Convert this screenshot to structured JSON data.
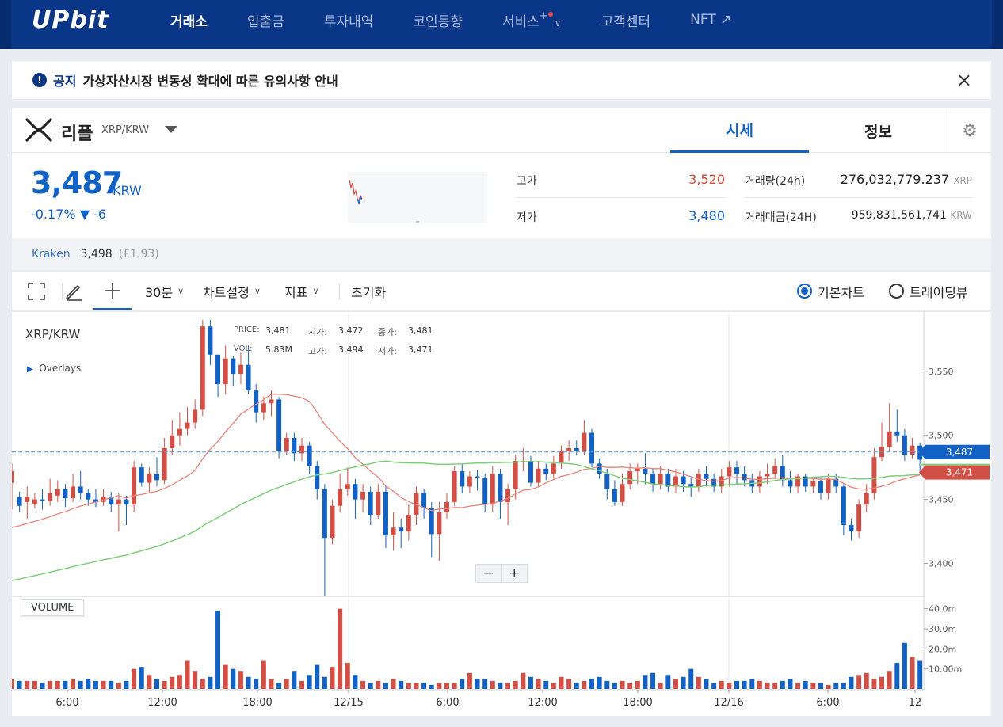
{
  "topnav": {
    "logo": "UPbit",
    "items": [
      "거래소",
      "입출금",
      "투자내역",
      "코인동향",
      "서비스",
      "고객센터",
      "NFT ↗"
    ],
    "plus": "+"
  },
  "notice": {
    "tag": "공지",
    "message": "가상자산시장 변동성 확대에 따른 유의사항 안내",
    "close": "×"
  },
  "coin": {
    "name": "리플",
    "pair": "XRP/KRW",
    "tabs": [
      "시세",
      "정보"
    ]
  },
  "price": {
    "current": "3,487",
    "unit": "KRW",
    "change": "-0.17% ▼ -6",
    "high_label": "고가",
    "high": "3,520",
    "low_label": "저가",
    "low": "3,480",
    "volume_label": "거래량(24h)",
    "volume": "276,032,779.237",
    "volume_unit": "XRP",
    "amount_label": "거래대금(24H)",
    "amount": "959,831,561,741",
    "amount_unit": "KRW"
  },
  "kraken": {
    "label": "Kraken",
    "price": "3,498",
    "gbp": "(£1.93)"
  },
  "toolbar": {
    "interval": "30분",
    "settings": "차트설정",
    "indicators": "지표",
    "reset": "초기화",
    "basic_chart": "기본차트",
    "trading_view": "트레이딩뷰"
  },
  "colors": {
    "up": "#d24f45",
    "down": "#1261c4",
    "brand": "#093687",
    "ma_short": "#e8837a",
    "ma_long": "#7fcf7a"
  },
  "chart_overlay": {
    "symbol": "XRP/KRW",
    "overlays": "Overlays",
    "price_label": "PRICE:",
    "price": "3,481",
    "open_label": "시가:",
    "open": "3,472",
    "close_label": "종가:",
    "close": "3,481",
    "vol_label": "VOL:",
    "vol": "5.83M",
    "high_label": "고가:",
    "high": "3,494",
    "low_label": "저가:",
    "low": "3,471",
    "volume_title": "VOLUME",
    "zoom_out": "−",
    "zoom_in": "+"
  },
  "chart_data": {
    "type": "candlestick",
    "x_tick_labels": [
      "6:00",
      "12:00",
      "18:00",
      "12/15",
      "6:00",
      "12:00",
      "18:00",
      "12/16",
      "6:00",
      "12"
    ],
    "y_tick_labels": [
      "3,550",
      "3,500",
      "3,450",
      "3,400"
    ],
    "ylim": [
      3375,
      3595
    ],
    "volume_tick_labels": [
      "40.0m",
      "30.0m",
      "20.0m",
      "10.00m"
    ],
    "volume_ylim": [
      0,
      45
    ],
    "current_price_tag": "3,487",
    "ma_tag": "3,471",
    "series": [
      {
        "name": "candles",
        "values": [
          [
            3463,
            3472,
            3478,
            3442
          ],
          [
            3452,
            3445,
            3456,
            3440
          ],
          [
            3448,
            3452,
            3460,
            3435
          ],
          [
            3446,
            3450,
            3455,
            3443
          ],
          [
            3450,
            3449,
            3458,
            3442
          ],
          [
            3449,
            3455,
            3466,
            3445
          ],
          [
            3453,
            3458,
            3465,
            3448
          ],
          [
            3458,
            3451,
            3462,
            3444
          ],
          [
            3451,
            3460,
            3470,
            3448
          ],
          [
            3460,
            3455,
            3472,
            3450
          ],
          [
            3455,
            3450,
            3458,
            3445
          ],
          [
            3450,
            3448,
            3458,
            3444
          ],
          [
            3448,
            3452,
            3458,
            3445
          ],
          [
            3452,
            3446,
            3456,
            3440
          ],
          [
            3446,
            3450,
            3455,
            3425
          ],
          [
            3450,
            3446,
            3453,
            3430
          ],
          [
            3446,
            3475,
            3480,
            3440
          ],
          [
            3475,
            3463,
            3478,
            3460
          ],
          [
            3463,
            3470,
            3475,
            3455
          ],
          [
            3470,
            3465,
            3483,
            3460
          ],
          [
            3465,
            3490,
            3498,
            3462
          ],
          [
            3490,
            3500,
            3512,
            3485
          ],
          [
            3500,
            3505,
            3518,
            3492
          ],
          [
            3505,
            3510,
            3522,
            3500
          ],
          [
            3510,
            3520,
            3528,
            3505
          ],
          [
            3520,
            3585,
            3590,
            3515
          ],
          [
            3585,
            3563,
            3590,
            3555
          ],
          [
            3563,
            3540,
            3558,
            3530
          ],
          [
            3540,
            3560,
            3570,
            3532
          ],
          [
            3560,
            3548,
            3562,
            3538
          ],
          [
            3548,
            3555,
            3565,
            3540
          ],
          [
            3555,
            3535,
            3570,
            3532
          ],
          [
            3535,
            3518,
            3540,
            3510
          ],
          [
            3518,
            3525,
            3530,
            3512
          ],
          [
            3525,
            3528,
            3535,
            3515
          ],
          [
            3528,
            3488,
            3530,
            3482
          ],
          [
            3488,
            3498,
            3502,
            3485
          ],
          [
            3498,
            3486,
            3502,
            3480
          ],
          [
            3486,
            3492,
            3498,
            3480
          ],
          [
            3492,
            3476,
            3495,
            3470
          ],
          [
            3476,
            3458,
            3480,
            3450
          ],
          [
            3458,
            3420,
            3462,
            3375
          ],
          [
            3420,
            3445,
            3450,
            3415
          ],
          [
            3445,
            3458,
            3470,
            3440
          ],
          [
            3458,
            3462,
            3475,
            3453
          ],
          [
            3462,
            3450,
            3466,
            3435
          ],
          [
            3450,
            3456,
            3462,
            3440
          ],
          [
            3456,
            3438,
            3460,
            3430
          ],
          [
            3438,
            3456,
            3462,
            3435
          ],
          [
            3456,
            3422,
            3460,
            3412
          ],
          [
            3422,
            3428,
            3440,
            3410
          ],
          [
            3428,
            3425,
            3435,
            3412
          ],
          [
            3425,
            3438,
            3446,
            3418
          ],
          [
            3438,
            3455,
            3460,
            3430
          ],
          [
            3455,
            3443,
            3458,
            3435
          ],
          [
            3443,
            3423,
            3448,
            3405
          ],
          [
            3423,
            3440,
            3448,
            3402
          ],
          [
            3440,
            3448,
            3455,
            3435
          ],
          [
            3448,
            3472,
            3476,
            3445
          ],
          [
            3472,
            3460,
            3478,
            3455
          ],
          [
            3460,
            3468,
            3472,
            3455
          ],
          [
            3468,
            3467,
            3473,
            3457
          ],
          [
            3467,
            3446,
            3470,
            3440
          ],
          [
            3446,
            3470,
            3476,
            3440
          ],
          [
            3470,
            3448,
            3474,
            3435
          ],
          [
            3448,
            3458,
            3462,
            3430
          ],
          [
            3458,
            3480,
            3485,
            3450
          ],
          [
            3480,
            3480,
            3490,
            3472
          ],
          [
            3480,
            3463,
            3484,
            3460
          ],
          [
            3463,
            3474,
            3480,
            3460
          ],
          [
            3474,
            3470,
            3478,
            3465
          ],
          [
            3470,
            3478,
            3484,
            3466
          ],
          [
            3478,
            3488,
            3492,
            3474
          ],
          [
            3488,
            3490,
            3496,
            3480
          ],
          [
            3490,
            3488,
            3496,
            3485
          ],
          [
            3488,
            3502,
            3512,
            3485
          ],
          [
            3502,
            3478,
            3505,
            3475
          ],
          [
            3478,
            3470,
            3482,
            3466
          ],
          [
            3470,
            3458,
            3474,
            3450
          ],
          [
            3458,
            3448,
            3465,
            3445
          ],
          [
            3448,
            3462,
            3470,
            3445
          ],
          [
            3462,
            3472,
            3478,
            3458
          ],
          [
            3472,
            3474,
            3478,
            3462
          ],
          [
            3474,
            3470,
            3486,
            3462
          ],
          [
            3470,
            3462,
            3474,
            3456
          ],
          [
            3462,
            3470,
            3476,
            3458
          ],
          [
            3470,
            3460,
            3474,
            3456
          ],
          [
            3460,
            3468,
            3474,
            3455
          ],
          [
            3468,
            3462,
            3472,
            3456
          ],
          [
            3462,
            3460,
            3468,
            3452
          ],
          [
            3460,
            3470,
            3474,
            3456
          ],
          [
            3470,
            3466,
            3476,
            3460
          ],
          [
            3466,
            3460,
            3470,
            3456
          ],
          [
            3460,
            3468,
            3474,
            3455
          ],
          [
            3468,
            3475,
            3480,
            3460
          ],
          [
            3475,
            3470,
            3480,
            3462
          ],
          [
            3470,
            3465,
            3476,
            3460
          ],
          [
            3465,
            3460,
            3470,
            3455
          ],
          [
            3460,
            3468,
            3472,
            3455
          ],
          [
            3468,
            3470,
            3478,
            3462
          ],
          [
            3470,
            3476,
            3482,
            3466
          ],
          [
            3476,
            3465,
            3485,
            3460
          ],
          [
            3465,
            3460,
            3472,
            3455
          ],
          [
            3460,
            3468,
            3470,
            3455
          ],
          [
            3468,
            3460,
            3470,
            3456
          ],
          [
            3460,
            3464,
            3468,
            3455
          ],
          [
            3464,
            3455,
            3468,
            3450
          ],
          [
            3455,
            3466,
            3470,
            3450
          ],
          [
            3466,
            3460,
            3470,
            3455
          ],
          [
            3460,
            3430,
            3462,
            3422
          ],
          [
            3430,
            3425,
            3435,
            3418
          ],
          [
            3425,
            3446,
            3450,
            3420
          ],
          [
            3446,
            3455,
            3462,
            3440
          ],
          [
            3455,
            3483,
            3490,
            3450
          ],
          [
            3483,
            3491,
            3510,
            3480
          ],
          [
            3491,
            3503,
            3525,
            3488
          ],
          [
            3503,
            3500,
            3520,
            3495
          ],
          [
            3500,
            3485,
            3505,
            3480
          ],
          [
            3485,
            3492,
            3498,
            3482
          ],
          [
            3492,
            3481,
            3494,
            3471
          ]
        ]
      },
      {
        "name": "volume",
        "values": [
          5,
          4,
          4,
          4,
          3,
          4,
          4,
          4,
          5,
          4,
          5,
          4,
          4,
          4,
          3,
          4,
          10,
          11,
          7,
          5,
          4,
          6,
          7,
          14,
          9,
          5,
          6,
          39,
          12,
          10,
          9,
          6,
          5,
          14,
          5,
          3,
          5,
          9,
          4,
          7,
          12,
          6,
          11,
          40,
          13,
          7,
          4,
          3,
          4,
          3,
          5,
          4,
          3,
          3,
          3,
          2,
          3,
          3,
          3,
          5,
          8,
          5,
          5,
          4,
          3,
          3,
          4,
          8,
          6,
          5,
          4,
          3,
          6,
          5,
          3,
          4,
          5,
          6,
          4,
          3,
          4,
          3,
          4,
          7,
          8,
          3,
          7,
          5,
          6,
          10,
          6,
          5,
          3,
          4,
          3,
          4,
          4,
          5,
          4,
          3,
          3,
          4,
          5,
          3,
          4,
          3,
          3,
          2,
          3,
          3,
          6,
          7,
          8,
          5,
          6,
          9,
          13,
          23,
          16,
          14,
          9,
          5,
          1
        ]
      }
    ]
  }
}
